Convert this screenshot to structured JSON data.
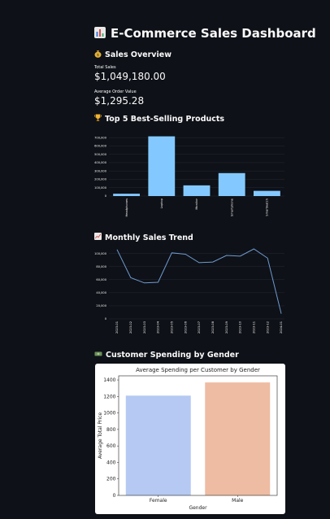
{
  "header": {
    "icon": "bar-chart-icon",
    "title": "E-Commerce Sales Dashboard"
  },
  "overview": {
    "icon": "money-bag-icon",
    "title": "Sales Overview",
    "total_sales_label": "Total Sales",
    "total_sales_value": "$1,049,180.00",
    "avg_order_label": "Average Order Value",
    "avg_order_value": "$1,295.28"
  },
  "top_products": {
    "icon": "trophy-icon",
    "title": "Top 5 Best-Selling Products"
  },
  "monthly_trend": {
    "icon": "line-chart-icon",
    "title": "Monthly Sales Trend"
  },
  "gender_spending": {
    "icon": "money-icon",
    "title": "Customer Spending by Gender"
  },
  "colors": {
    "bg": "#0e1117",
    "bar_blue": "#83c9ff",
    "line_blue": "#6f9bd1",
    "female": "#b5c9f2",
    "male": "#eebca2"
  },
  "chart_data": [
    {
      "type": "bar",
      "categories": [
        "Headphones",
        "Laptop",
        "Monitor",
        "Smartphone",
        "Smartwatch"
      ],
      "values": [
        28000,
        715000,
        128000,
        275000,
        62000
      ],
      "ylim": [
        0,
        750000
      ],
      "yticks": [
        0,
        100000,
        200000,
        300000,
        400000,
        500000,
        600000,
        700000
      ],
      "ytick_labels": [
        "0",
        "100,000",
        "200,000",
        "300,000",
        "400,000",
        "500,000",
        "600,000",
        "700,000"
      ],
      "color": "#83c9ff",
      "grid": true
    },
    {
      "type": "line",
      "x": [
        "2023-01",
        "2023-02",
        "2023-03",
        "2023-04",
        "2023-05",
        "2023-06",
        "2023-07",
        "2023-08",
        "2023-09",
        "2023-10",
        "2023-11",
        "2023-12",
        "2024-01"
      ],
      "values": [
        106000,
        63000,
        55000,
        56000,
        101000,
        99000,
        86000,
        87000,
        97000,
        96000,
        107000,
        93000,
        8000
      ],
      "ylim": [
        0,
        112000
      ],
      "yticks": [
        0,
        20000,
        40000,
        60000,
        80000,
        100000
      ],
      "ytick_labels": [
        "0",
        "20,000",
        "40,000",
        "60,000",
        "80,000",
        "100,000"
      ],
      "color": "#6f9bd1",
      "grid": true
    },
    {
      "type": "bar",
      "title": "Average Spending per Customer by Gender",
      "xlabel": "Gender",
      "ylabel": "Average Total Price",
      "categories": [
        "Female",
        "Male"
      ],
      "values": [
        1210,
        1370
      ],
      "ylim": [
        0,
        1450
      ],
      "yticks": [
        0,
        200,
        400,
        600,
        800,
        1000,
        1200,
        1400
      ],
      "ytick_labels": [
        "0",
        "200",
        "400",
        "600",
        "800",
        "1000",
        "1200",
        "1400"
      ],
      "colors": [
        "#b5c9f2",
        "#eebca2"
      ],
      "grid": false
    }
  ]
}
